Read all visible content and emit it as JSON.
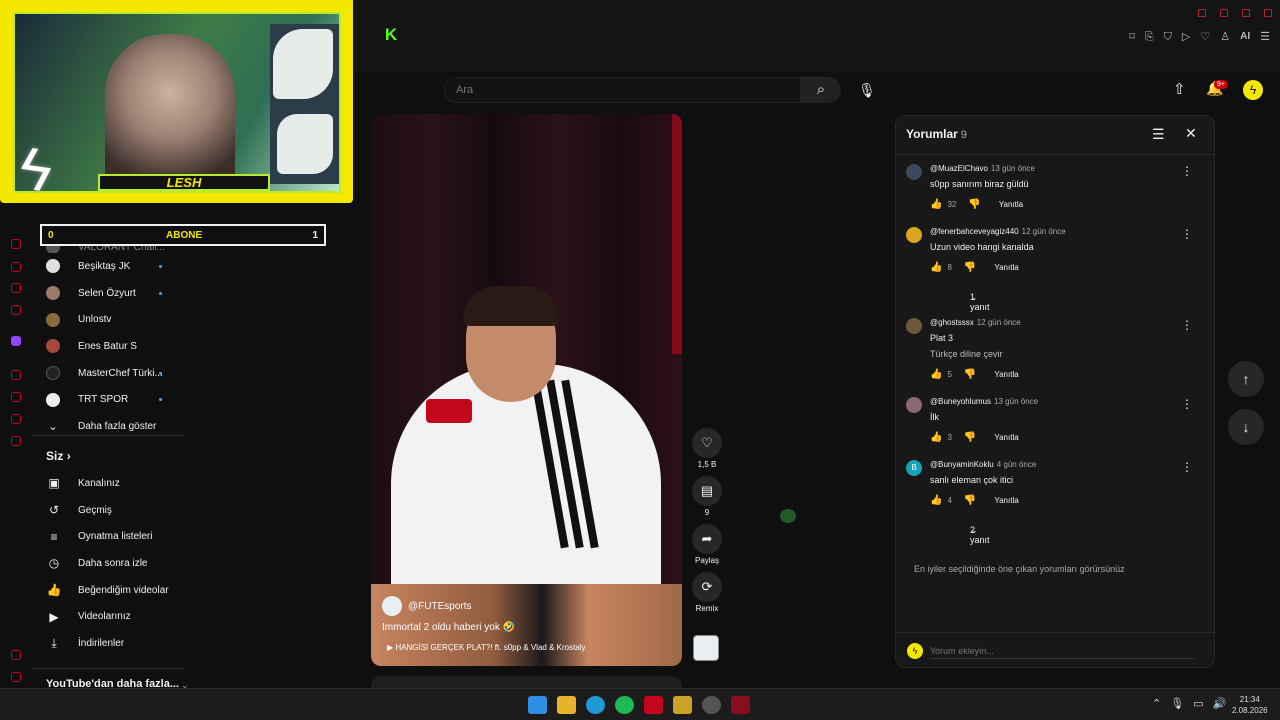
{
  "overlay": {
    "streamer_name": "LESH",
    "abone_label": "ABONE",
    "abone_left": "0",
    "abone_right": "1"
  },
  "header": {
    "search_placeholder": "Ara",
    "notification_badge": "9+",
    "extension_ai_label": "AI"
  },
  "sidebar": {
    "subscriptions": [
      {
        "label": "VALORANT Chall...",
        "dot": false
      },
      {
        "label": "Beşiktaş JK",
        "dot": true
      },
      {
        "label": "Selen Özyurt",
        "dot": true
      },
      {
        "label": "Unlostv",
        "dot": false
      },
      {
        "label": "Enes Batur S",
        "dot": false
      },
      {
        "label": "MasterChef Türki...",
        "dot": true
      },
      {
        "label": "TRT SPOR",
        "dot": true
      },
      {
        "label": "Daha fazla göster",
        "dot": false
      }
    ],
    "you_heading": "Siz",
    "you_items": [
      {
        "label": "Kanalınız",
        "icon": "channel-icon"
      },
      {
        "label": "Geçmiş",
        "icon": "history-icon"
      },
      {
        "label": "Oynatma listeleri",
        "icon": "playlists-icon"
      },
      {
        "label": "Daha sonra izle",
        "icon": "watch-later-icon"
      },
      {
        "label": "Beğendiğim videolar",
        "icon": "liked-icon"
      },
      {
        "label": "Videolarınız",
        "icon": "your-videos-icon"
      },
      {
        "label": "İndirilenler",
        "icon": "downloads-icon"
      }
    ],
    "more_from_youtube": "YouTube'dan daha fazla..."
  },
  "short": {
    "channel": "@FUTEsports",
    "title": "Immortal 2 oldu haberi yok 🤣",
    "linked_video": "▶ HANGİSİ GERÇEK PLAT?! ft. s0pp & Vlad & Krostaly",
    "likes": "1,5 B",
    "comments_count": "9",
    "share_label": "Paylaş",
    "remix_label": "Remix"
  },
  "comments_panel": {
    "title": "Yorumlar",
    "count": "9",
    "items": [
      {
        "author": "@MuazElChavo",
        "age": "13 gün önce",
        "text": "s0pp sanırım biraz güldü",
        "text2": "",
        "likes": "32",
        "reply": "Yanıtla",
        "avatar": "",
        "avatar_color": "#3a4a5a"
      },
      {
        "author": "@fenerbahceveyagiz440",
        "age": "12 gün önce",
        "text": "Uzun video hangi kanalda",
        "text2": "",
        "likes": "8",
        "reply": "Yanıtla",
        "avatar": "",
        "avatar_color": "#d9a520"
      },
      {
        "author": "@ghostsssx",
        "age": "12 gün önce",
        "text": "Plat 3",
        "text2": "Türkçe diline çevir",
        "likes": "5",
        "reply": "Yanıtla",
        "avatar": "",
        "avatar_color": "#6b5a3a"
      },
      {
        "author": "@Buneyohlumus",
        "age": "13 gün önce",
        "text": "İlk",
        "text2": "",
        "likes": "3",
        "reply": "Yanıtla",
        "avatar": "",
        "avatar_color": "#8a6a70"
      },
      {
        "author": "@BunyaminKoklu",
        "age": "4 gün önce",
        "text": "sanlı eleman çok itici",
        "text2": "",
        "likes": "4",
        "reply": "Yanıtla",
        "avatar": "B",
        "avatar_color": "#12a3b5"
      }
    ],
    "replies_1": "1 yanıt",
    "replies_2": "2 yanıt",
    "note": "En iyiler seçildiğinde öne çıkan yorumları görürsünüz",
    "input_placeholder": "Yorum ekleyin..."
  },
  "taskbar": {
    "time": "21:34",
    "date": "2.08.2026"
  }
}
